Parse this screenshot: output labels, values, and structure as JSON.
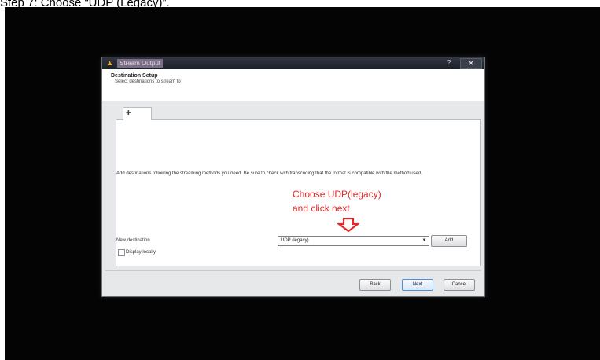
{
  "caption": "Step 7: Choose “UDP (Legacy)”.",
  "window": {
    "title": "Stream Output",
    "help_label": "?",
    "close_label": "✕"
  },
  "header": {
    "title": "Destination Setup",
    "subtitle": "Select destinations to stream to"
  },
  "tab": {
    "icon": "plus-icon",
    "glyph": "✚"
  },
  "panel": {
    "description": "Add destinations following the streaming methods you need. Be sure to check with transcoding that the format is compatible with the method used.",
    "new_destination_label": "New destination",
    "destination_value": "UDP (legacy)",
    "dropdown_glyph": "▼",
    "add_label": "Add",
    "display_locally_label": "Display locally"
  },
  "annotation": {
    "line1": "Choose UDP(legacy)",
    "line2": "and click next",
    "color": "#e2282a"
  },
  "footer": {
    "back_label": "Back",
    "next_label": "Next",
    "cancel_label": "Cancel"
  }
}
